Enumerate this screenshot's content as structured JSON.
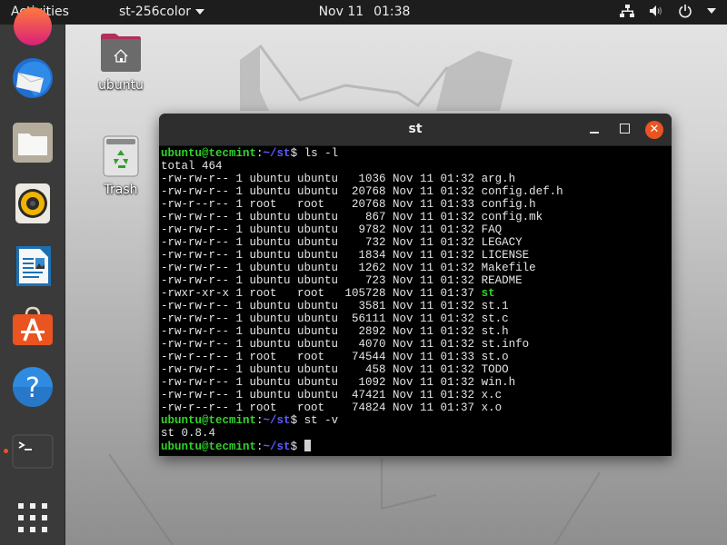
{
  "topbar": {
    "activities": "Activities",
    "app_menu": "st-256color",
    "clock_date": "Nov 11",
    "clock_time": "01:38",
    "tray_icons": [
      "network-icon",
      "volume-icon",
      "power-icon",
      "system-menu-arrow"
    ]
  },
  "dock": {
    "items": [
      {
        "name": "firefox",
        "icon": "firefox-icon",
        "running": false
      },
      {
        "name": "thunderbird",
        "icon": "thunderbird-icon",
        "running": false
      },
      {
        "name": "files",
        "icon": "folder-icon",
        "running": false
      },
      {
        "name": "rhythmbox",
        "icon": "speaker-icon",
        "running": false
      },
      {
        "name": "libreoffice-writer",
        "icon": "document-icon",
        "running": false
      },
      {
        "name": "ubuntu-software",
        "icon": "shopping-bag-icon",
        "running": false
      },
      {
        "name": "help",
        "icon": "help-icon",
        "running": false
      },
      {
        "name": "terminal",
        "icon": "terminal-icon",
        "running": true
      },
      {
        "name": "show-applications",
        "icon": "app-grid-icon",
        "running": false
      }
    ],
    "accent_color": "#e95420"
  },
  "desktop": {
    "icons": [
      {
        "label": "ubuntu",
        "icon": "home-folder-icon"
      },
      {
        "label": "Trash",
        "icon": "trash-icon"
      }
    ]
  },
  "window": {
    "title": "st",
    "close_symbol": "✕"
  },
  "terminal": {
    "prompt": {
      "user_host": "ubuntu@tecmint",
      "sep": ":",
      "path": "~/st",
      "dollar": "$"
    },
    "commands": [
      "ls -l",
      "st -v",
      ""
    ],
    "total": "total 464",
    "listing": [
      {
        "perms": "-rw-rw-r--",
        "links": "1",
        "owner": "ubuntu",
        "group": "ubuntu",
        "size": "1036",
        "date": "Nov 11 01:32",
        "name": "arg.h",
        "exec": false
      },
      {
        "perms": "-rw-rw-r--",
        "links": "1",
        "owner": "ubuntu",
        "group": "ubuntu",
        "size": "20768",
        "date": "Nov 11 01:32",
        "name": "config.def.h",
        "exec": false
      },
      {
        "perms": "-rw-r--r--",
        "links": "1",
        "owner": "root",
        "group": "root",
        "size": "20768",
        "date": "Nov 11 01:33",
        "name": "config.h",
        "exec": false
      },
      {
        "perms": "-rw-rw-r--",
        "links": "1",
        "owner": "ubuntu",
        "group": "ubuntu",
        "size": "867",
        "date": "Nov 11 01:32",
        "name": "config.mk",
        "exec": false
      },
      {
        "perms": "-rw-rw-r--",
        "links": "1",
        "owner": "ubuntu",
        "group": "ubuntu",
        "size": "9782",
        "date": "Nov 11 01:32",
        "name": "FAQ",
        "exec": false
      },
      {
        "perms": "-rw-rw-r--",
        "links": "1",
        "owner": "ubuntu",
        "group": "ubuntu",
        "size": "732",
        "date": "Nov 11 01:32",
        "name": "LEGACY",
        "exec": false
      },
      {
        "perms": "-rw-rw-r--",
        "links": "1",
        "owner": "ubuntu",
        "group": "ubuntu",
        "size": "1834",
        "date": "Nov 11 01:32",
        "name": "LICENSE",
        "exec": false
      },
      {
        "perms": "-rw-rw-r--",
        "links": "1",
        "owner": "ubuntu",
        "group": "ubuntu",
        "size": "1262",
        "date": "Nov 11 01:32",
        "name": "Makefile",
        "exec": false
      },
      {
        "perms": "-rw-rw-r--",
        "links": "1",
        "owner": "ubuntu",
        "group": "ubuntu",
        "size": "723",
        "date": "Nov 11 01:32",
        "name": "README",
        "exec": false
      },
      {
        "perms": "-rwxr-xr-x",
        "links": "1",
        "owner": "root",
        "group": "root",
        "size": "105728",
        "date": "Nov 11 01:37",
        "name": "st",
        "exec": true
      },
      {
        "perms": "-rw-rw-r--",
        "links": "1",
        "owner": "ubuntu",
        "group": "ubuntu",
        "size": "3581",
        "date": "Nov 11 01:32",
        "name": "st.1",
        "exec": false
      },
      {
        "perms": "-rw-rw-r--",
        "links": "1",
        "owner": "ubuntu",
        "group": "ubuntu",
        "size": "56111",
        "date": "Nov 11 01:32",
        "name": "st.c",
        "exec": false
      },
      {
        "perms": "-rw-rw-r--",
        "links": "1",
        "owner": "ubuntu",
        "group": "ubuntu",
        "size": "2892",
        "date": "Nov 11 01:32",
        "name": "st.h",
        "exec": false
      },
      {
        "perms": "-rw-rw-r--",
        "links": "1",
        "owner": "ubuntu",
        "group": "ubuntu",
        "size": "4070",
        "date": "Nov 11 01:32",
        "name": "st.info",
        "exec": false
      },
      {
        "perms": "-rw-r--r--",
        "links": "1",
        "owner": "root",
        "group": "root",
        "size": "74544",
        "date": "Nov 11 01:33",
        "name": "st.o",
        "exec": false
      },
      {
        "perms": "-rw-rw-r--",
        "links": "1",
        "owner": "ubuntu",
        "group": "ubuntu",
        "size": "458",
        "date": "Nov 11 01:32",
        "name": "TODO",
        "exec": false
      },
      {
        "perms": "-rw-rw-r--",
        "links": "1",
        "owner": "ubuntu",
        "group": "ubuntu",
        "size": "1092",
        "date": "Nov 11 01:32",
        "name": "win.h",
        "exec": false
      },
      {
        "perms": "-rw-rw-r--",
        "links": "1",
        "owner": "ubuntu",
        "group": "ubuntu",
        "size": "47421",
        "date": "Nov 11 01:32",
        "name": "x.c",
        "exec": false
      },
      {
        "perms": "-rw-r--r--",
        "links": "1",
        "owner": "root",
        "group": "root",
        "size": "74824",
        "date": "Nov 11 01:37",
        "name": "x.o",
        "exec": false
      }
    ],
    "version_output": "st 0.8.4",
    "colors": {
      "user_host": "#32d32b",
      "path": "#5c5cff",
      "text": "#e5e5e5",
      "exec": "#32d32b",
      "background": "#000000"
    }
  }
}
